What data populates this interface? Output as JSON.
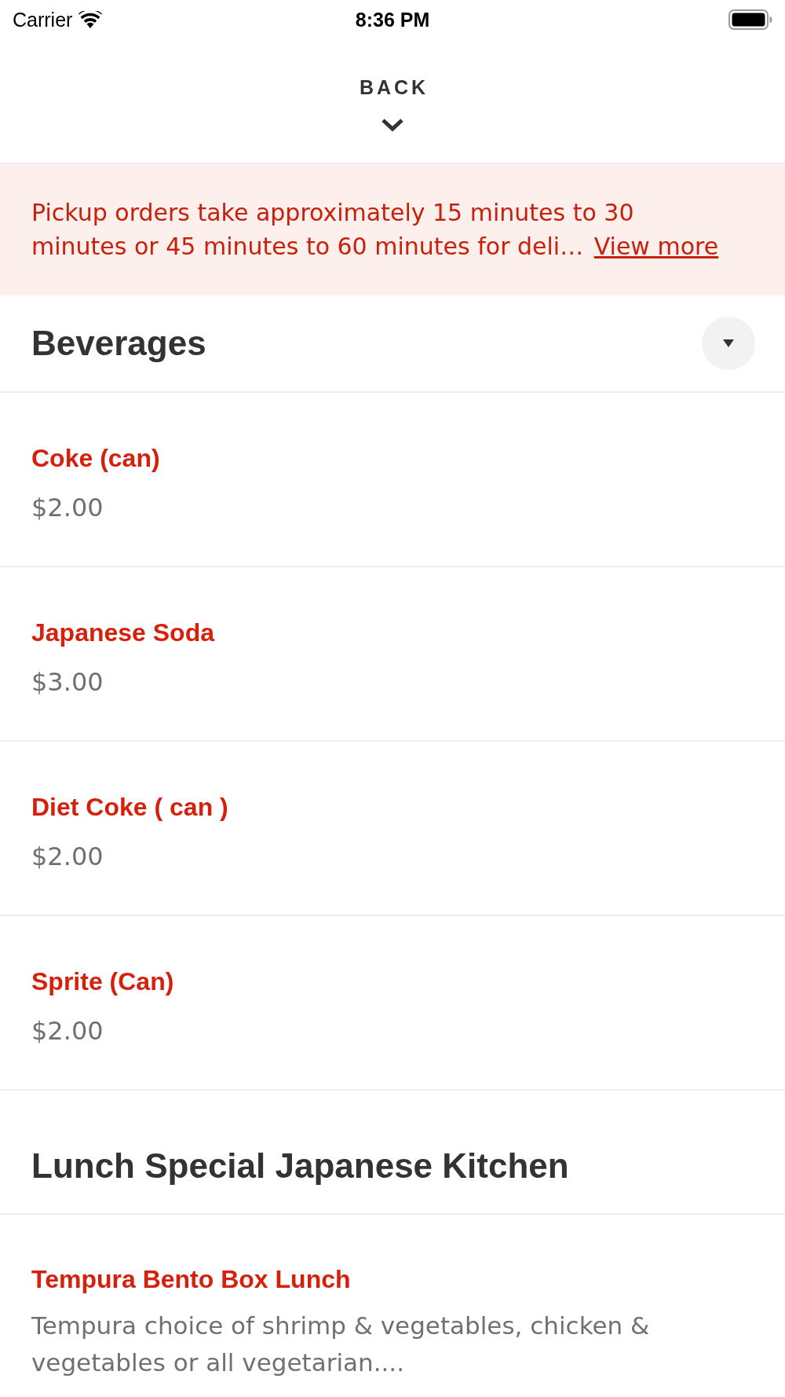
{
  "status_bar": {
    "carrier": "Carrier",
    "time": "8:36 PM"
  },
  "header": {
    "back_label": "BACK"
  },
  "notice": {
    "text": "Pickup orders take approximately 15 minutes to 30 minutes or 45 minutes to 60 minutes for deli…",
    "link": "View more"
  },
  "sections": [
    {
      "title": "Beverages",
      "collapse_button": true,
      "items": [
        {
          "name": "Coke (can)",
          "price": "$2.00"
        },
        {
          "name": "Japanese Soda",
          "price": "$3.00"
        },
        {
          "name": "Diet Coke ( can )",
          "price": "$2.00"
        },
        {
          "name": "Sprite (Can)",
          "price": "$2.00"
        }
      ]
    },
    {
      "title": "Lunch Special Japanese Kitchen",
      "collapse_button": false,
      "items": [
        {
          "name": "Tempura Bento Box Lunch",
          "description": "Tempura choice of shrimp & vegetables, chicken & vegetables or all vegetarian...."
        }
      ]
    }
  ]
}
